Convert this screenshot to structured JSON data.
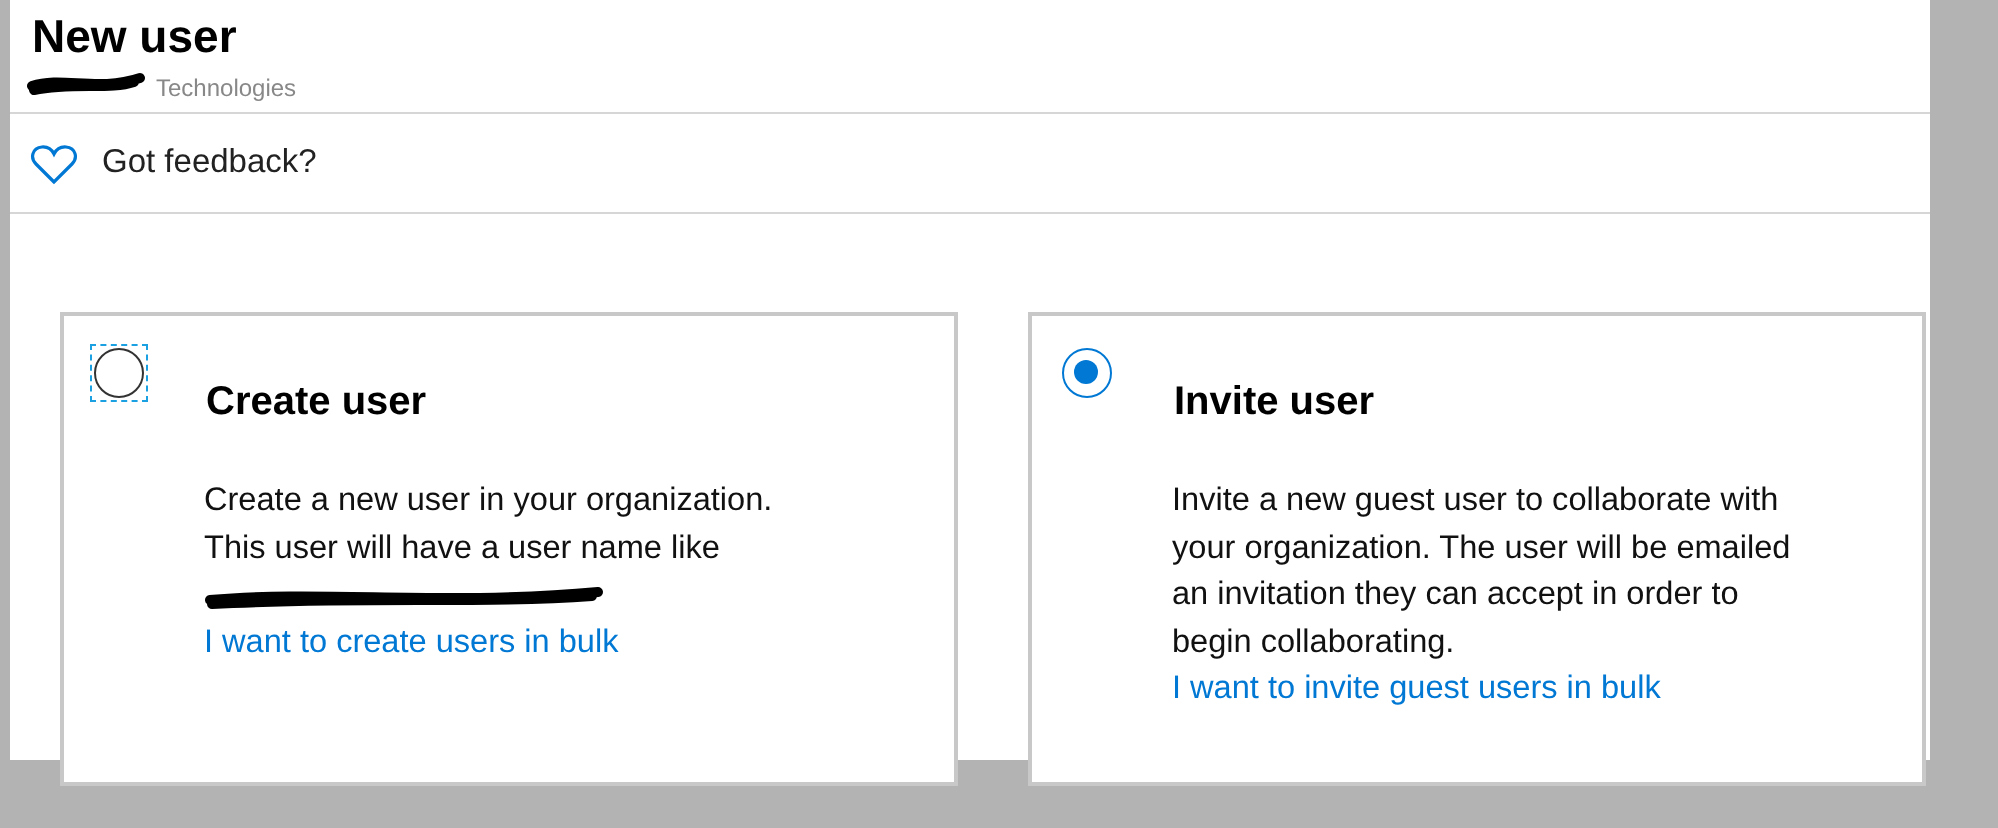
{
  "header": {
    "title": "New user",
    "subtitle": "Technologies",
    "subtitle_redacted": true
  },
  "feedback": {
    "label": "Got feedback?"
  },
  "options": [
    {
      "title": "Create user",
      "selected": false,
      "focused": true,
      "lines": [
        {
          "kind": "text",
          "text": "Create a new user in your organization. This user will have a user name like"
        },
        {
          "kind": "redacted"
        }
      ],
      "link": "I want to create users in bulk"
    },
    {
      "title": "Invite user",
      "selected": true,
      "focused": false,
      "lines": [
        {
          "kind": "text",
          "text": "Invite a new guest user to collaborate with your organization. The user will be emailed an invitation they can accept in order to begin collaborating."
        }
      ],
      "link": "I want to invite guest users in bulk"
    }
  ]
}
